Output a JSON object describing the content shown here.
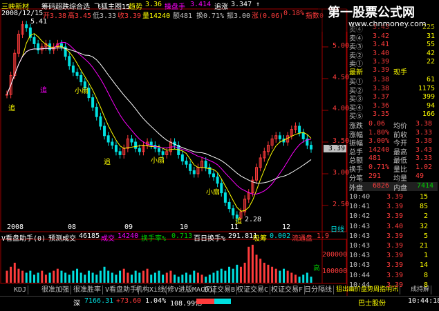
{
  "header": {
    "stock_name": "三峡新材",
    "tool_a": "筹码超跌综合选",
    "tool_b": "飞狐主图15",
    "trend_label": "趋势",
    "trend_value": "3.36",
    "operator_label": "操盘手",
    "operator_value": "3.414",
    "chase_label": "追涨",
    "chase_value": "3.347",
    "chase_arrow": "↑",
    "peak_price": "5.41"
  },
  "ohlc": {
    "date": "2008/12/15",
    "open": "开3.38",
    "high": "高3.45",
    "low": "低3.33",
    "close": "收3.39",
    "vol": "量14240",
    "amount": "额481",
    "turnover": "换0.71%",
    "amp": "振3.00",
    "rise": "涨(0.06)",
    "pct": "0.18%",
    "index": "指数0"
  },
  "price_axis": [
    "5.00",
    "4.50",
    "4.00",
    "3.50",
    "3.00",
    "2.50"
  ],
  "price_tag": "3.39",
  "month_labels": [
    "2008",
    "08",
    "09",
    "10",
    "11",
    "12"
  ],
  "signals": {
    "zhui": "追",
    "xiaoda": "小扇",
    "low_label": "2.28",
    "low_chase": "追"
  },
  "volume_header": {
    "title": "V看盘助手(0)",
    "pred_label": "预测成交",
    "pred_value": "46185",
    "chengjiao_label": "成交",
    "chengjiao_value": "14240",
    "huanshou_label": "换手率%",
    "huanshou_value": "0.713",
    "hundred_label": "百日换手%",
    "hundred_value": "291.811",
    "xishou_label": "吸筹",
    "xishou_value": "0.002",
    "liutong_label": "流通盘",
    "liutong_value": "1.9"
  },
  "volume_axis": [
    "200000",
    "100000"
  ],
  "volume_note": "高",
  "tabs": [
    "KDJ",
    "很准加强",
    "很准胜率",
    "V看盘助手",
    "机构Xi线",
    "(修V进版MACD)",
    "权证交易B",
    "权证交易C",
    "权证交易F",
    "日分隔线",
    "狙出幽价盘势周指明讯",
    "成持解"
  ],
  "index_bar": {
    "market": "深",
    "value": "7166.31",
    "change": "+73.60",
    "pct": "1.04%",
    "amount": "108.99亿",
    "broker": "巴士股份",
    "time": "10:44:18"
  },
  "order_book": {
    "sell": [
      {
        "label": "卖④",
        "price": "3.43",
        "vol": "225"
      },
      {
        "label": "卖④",
        "price": "3.42",
        "vol": "31"
      },
      {
        "label": "卖③",
        "price": "3.41",
        "vol": "55"
      },
      {
        "label": "卖②",
        "price": "3.40",
        "vol": "42"
      },
      {
        "label": "卖①",
        "price": "3.39",
        "vol": "22"
      }
    ],
    "latest_label": "最新",
    "latest_price": "3.39",
    "latest_tag": "现手",
    "buy": [
      {
        "label": "买①",
        "price": "3.38",
        "vol": "61"
      },
      {
        "label": "买②",
        "price": "3.38",
        "vol": "1175"
      },
      {
        "label": "买③",
        "price": "3.37",
        "vol": "399"
      },
      {
        "label": "买④",
        "price": "3.36",
        "vol": "94"
      },
      {
        "label": "买⑤",
        "price": "3.35",
        "vol": "166"
      }
    ]
  },
  "stats": [
    {
      "l1": "涨跌",
      "v1": "0.06",
      "l2": "均价",
      "v2": "3.38"
    },
    {
      "l1": "涨幅",
      "v1": "1.80%",
      "l2": "前收",
      "v2": "3.33"
    },
    {
      "l1": "振幅",
      "v1": "3.00%",
      "l2": "今开",
      "v2": "3.38"
    },
    {
      "l1": "总手",
      "v1": "14240",
      "l2": "最高",
      "v2": "3.43"
    },
    {
      "l1": "总额",
      "v1": "481",
      "l2": "最低",
      "v2": "3.33"
    },
    {
      "l1": "换手",
      "v1": "0.71%",
      "l2": "量比",
      "v2": "1.02"
    },
    {
      "l1": "分笔",
      "v1": "291",
      "l2": "均量",
      "v2": "49"
    }
  ],
  "outer_inner": {
    "out_label": "外盘",
    "out_value": "6826",
    "in_label": "内盘",
    "in_value": "7414"
  },
  "ticks": [
    {
      "time": "10:40",
      "price": "3.39",
      "vol": "15"
    },
    {
      "time": "10:41",
      "price": "3.39",
      "vol": "85"
    },
    {
      "time": "10:42",
      "price": "3.39",
      "vol": "2"
    },
    {
      "time": "10:43",
      "price": "3.40",
      "vol": "32"
    },
    {
      "time": "10:43",
      "price": "3.39",
      "vol": "5"
    },
    {
      "time": "10:43",
      "price": "3.39",
      "vol": "21"
    },
    {
      "time": "10:43",
      "price": "3.39",
      "vol": "1"
    },
    {
      "time": "10:43",
      "price": "3.39",
      "vol": "14"
    },
    {
      "time": "10:44",
      "price": "3.39",
      "vol": "8"
    },
    {
      "time": "10:44",
      "price": "3.39",
      "vol": "8"
    }
  ],
  "watermark": {
    "line1": "第一股票公式网",
    "line2": "www.chnmoney.com"
  },
  "colors": {
    "up": "#ff3c3c",
    "down": "#00e0e0",
    "yellow": "#ffff00",
    "magenta": "#ff00ff",
    "white": "#ffffff",
    "green": "#00d000",
    "axis": "#c00000"
  }
}
